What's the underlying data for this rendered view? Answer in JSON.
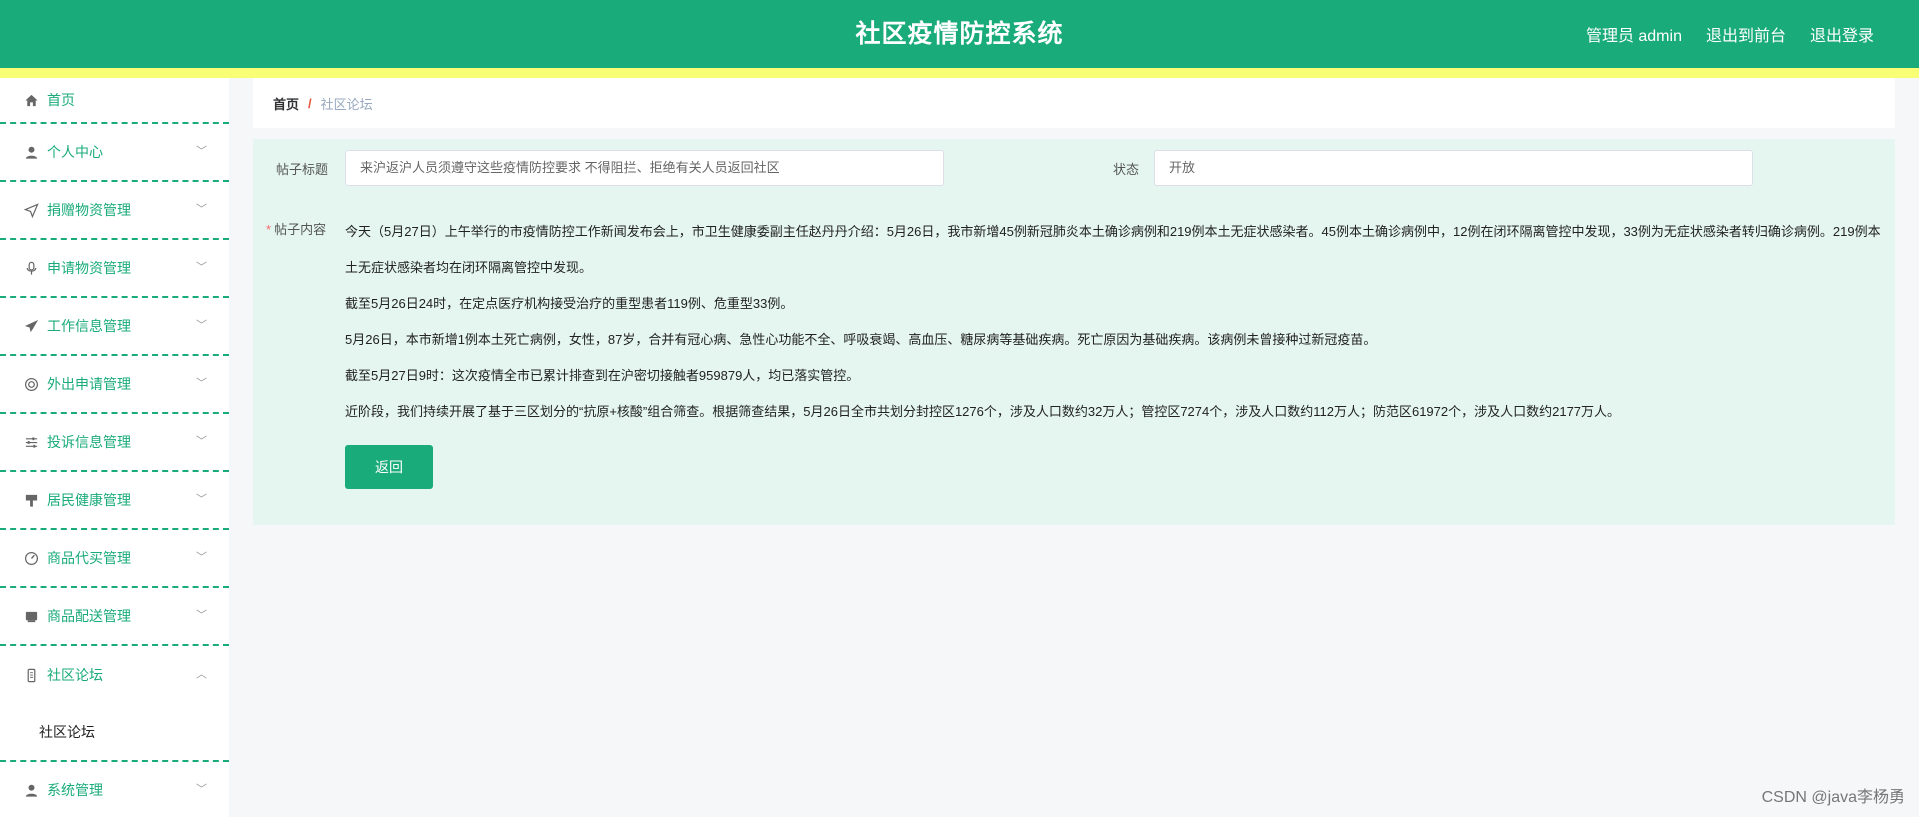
{
  "header": {
    "title": "社区疫情防控系统",
    "admin_label": "管理员 admin",
    "to_front": "退出到前台",
    "logout": "退出登录"
  },
  "sidebar": {
    "items": [
      {
        "label": "首页",
        "icon": "home-icon"
      },
      {
        "label": "个人中心",
        "icon": "user-icon"
      },
      {
        "label": "捐赠物资管理",
        "icon": "send-icon"
      },
      {
        "label": "申请物资管理",
        "icon": "microphone-icon"
      },
      {
        "label": "工作信息管理",
        "icon": "paper-plane-icon"
      },
      {
        "label": "外出申请管理",
        "icon": "lifebuoy-icon"
      },
      {
        "label": "投诉信息管理",
        "icon": "sliders-icon"
      },
      {
        "label": "居民健康管理",
        "icon": "brush-icon"
      },
      {
        "label": "商品代买管理",
        "icon": "gauge-icon"
      },
      {
        "label": "商品配送管理",
        "icon": "box-icon"
      },
      {
        "label": "社区论坛",
        "icon": "phone-icon"
      },
      {
        "label": "系统管理",
        "icon": "user-icon"
      }
    ],
    "submenu_label": "社区论坛"
  },
  "breadcrumb": {
    "home": "首页",
    "separator": "/",
    "current": "社区论坛"
  },
  "form": {
    "title_label": "帖子标题",
    "title_value": "来沪返沪人员须遵守这些疫情防控要求 不得阻拦、拒绝有关人员返回社区",
    "status_label": "状态",
    "status_value": "开放",
    "content_required": "*",
    "content_label": "帖子内容",
    "paragraphs": [
      "今天（5月27日）上午举行的市疫情防控工作新闻发布会上，市卫生健康委副主任赵丹丹介绍：5月26日，我市新增45例新冠肺炎本土确诊病例和219例本土无症状感染者。45例本土确诊病例中，12例在闭环隔离管控中发现，33例为无症状感染者转归确诊病例。219例本土无症状感染者均在闭环隔离管控中发现。",
      "截至5月26日24时，在定点医疗机构接受治疗的重型患者119例、危重型33例。",
      "5月26日，本市新增1例本土死亡病例，女性，87岁，合并有冠心病、急性心功能不全、呼吸衰竭、高血压、糖尿病等基础疾病。死亡原因为基础疾病。该病例未曾接种过新冠疫苗。",
      "截至5月27日9时：这次疫情全市已累计排查到在沪密切接触者959879人，均已落实管控。",
      "近阶段，我们持续开展了基于三区划分的“抗原+核酸”组合筛查。根据筛查结果，5月26日全市共划分封控区1276个，涉及人口数约32万人；管控区7274个，涉及人口数约112万人；防范区61972个，涉及人口数约2177万人。"
    ],
    "back_button": "返回"
  },
  "watermark": "CSDN @java李杨勇",
  "colors": {
    "primary": "#1aab7a",
    "accent_bar": "#f9ff74",
    "panel_bg": "#e4f6ef"
  }
}
